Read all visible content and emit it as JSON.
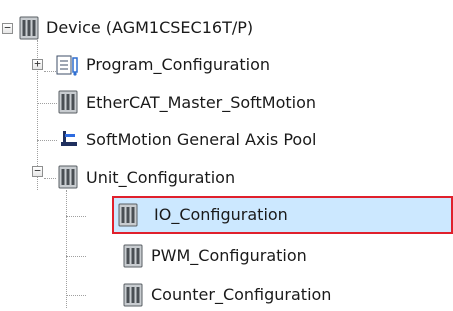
{
  "tree": {
    "root": {
      "label": "Device (AGM1CSEC16T/P)",
      "icon": "device-icon",
      "expanded": true
    },
    "children": [
      {
        "label": "Program_Configuration",
        "icon": "program-config-icon",
        "expanded": false
      },
      {
        "label": "EtherCAT_Master_SoftMotion",
        "icon": "device-icon"
      },
      {
        "label": "SoftMotion General Axis Pool",
        "icon": "axis-pool-icon"
      },
      {
        "label": "Unit_Configuration",
        "icon": "device-icon",
        "expanded": true,
        "children": [
          {
            "label": "IO_Configuration",
            "icon": "device-icon",
            "selected": true
          },
          {
            "label": "PWM_Configuration",
            "icon": "device-icon"
          },
          {
            "label": "Counter_Configuration",
            "icon": "device-icon"
          }
        ]
      }
    ]
  },
  "colors": {
    "selection_bg": "#cce8ff",
    "selection_border": "#e0202c"
  }
}
